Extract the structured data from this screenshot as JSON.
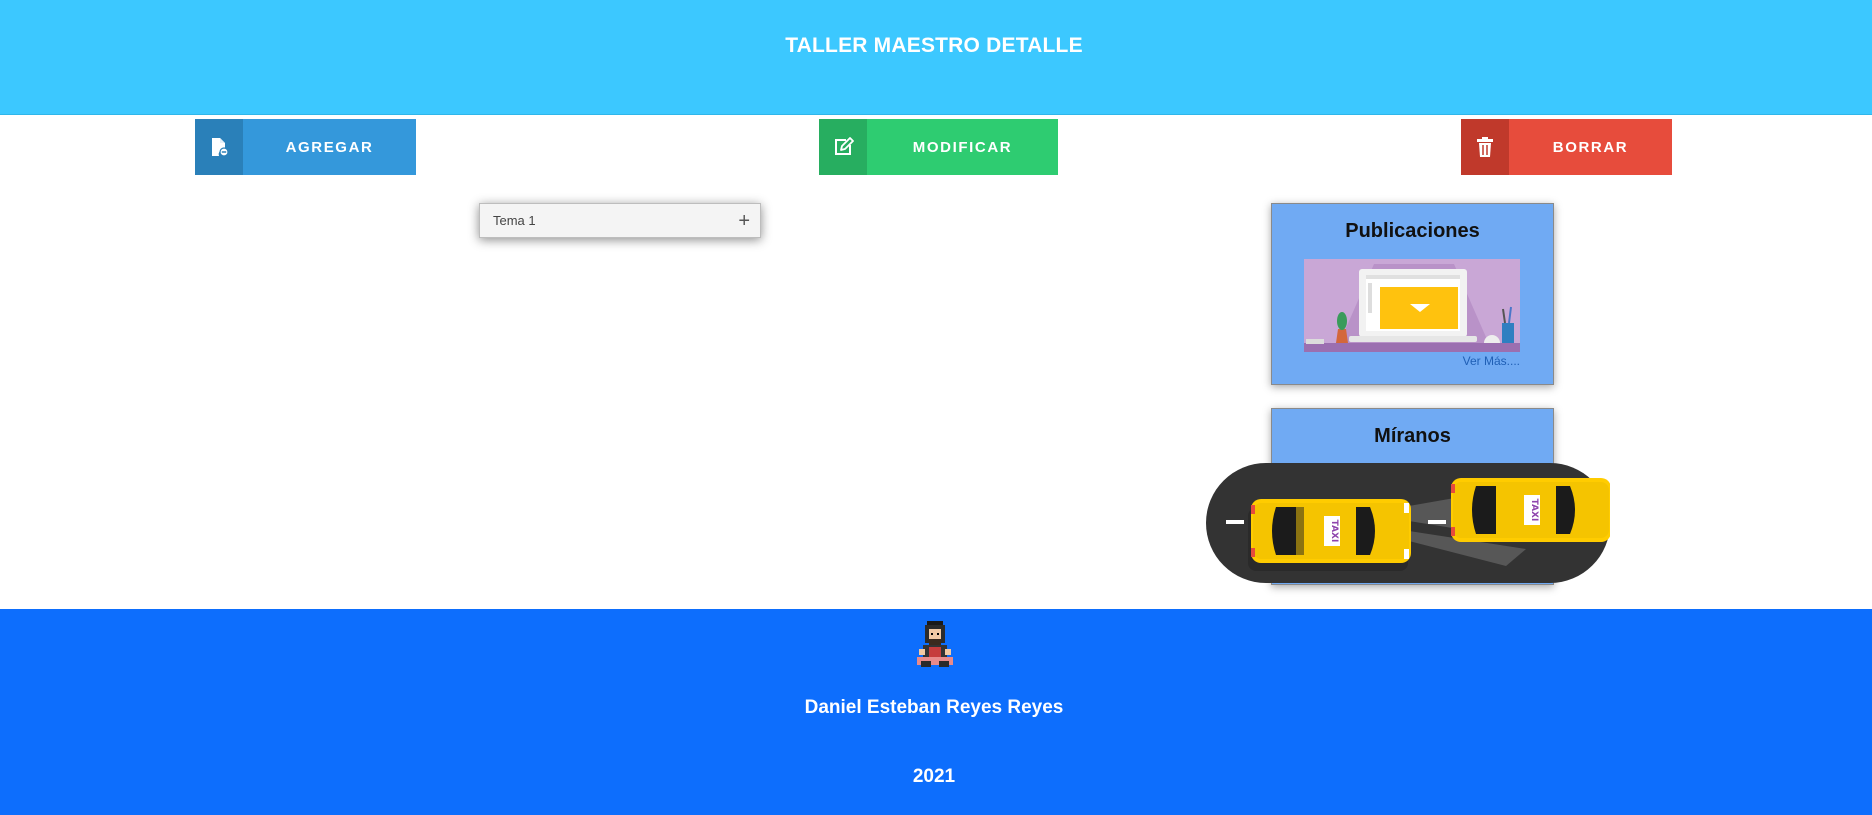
{
  "header": {
    "title": "TALLER MAESTRO DETALLE"
  },
  "toolbar": {
    "add_label": "AGREGAR",
    "modify_label": "MODIFICAR",
    "delete_label": "BORRAR",
    "add_icon": "file-add-icon",
    "modify_icon": "edit-icon",
    "delete_icon": "trash-icon"
  },
  "accordion": {
    "item_label": "Tema 1",
    "expand_icon": "plus-icon"
  },
  "cards": {
    "publicaciones": {
      "title": "Publicaciones",
      "link": "Ver Más...."
    },
    "miranos": {
      "title": "Míranos"
    }
  },
  "footer": {
    "name": "Daniel Esteban Reyes Reyes",
    "year": "2021"
  },
  "colors": {
    "header": "#3cc8ff",
    "add": "#3498db",
    "modify": "#2ecc71",
    "delete": "#e74c3c",
    "card": "#70aaf3",
    "footer": "#0d6efd"
  }
}
